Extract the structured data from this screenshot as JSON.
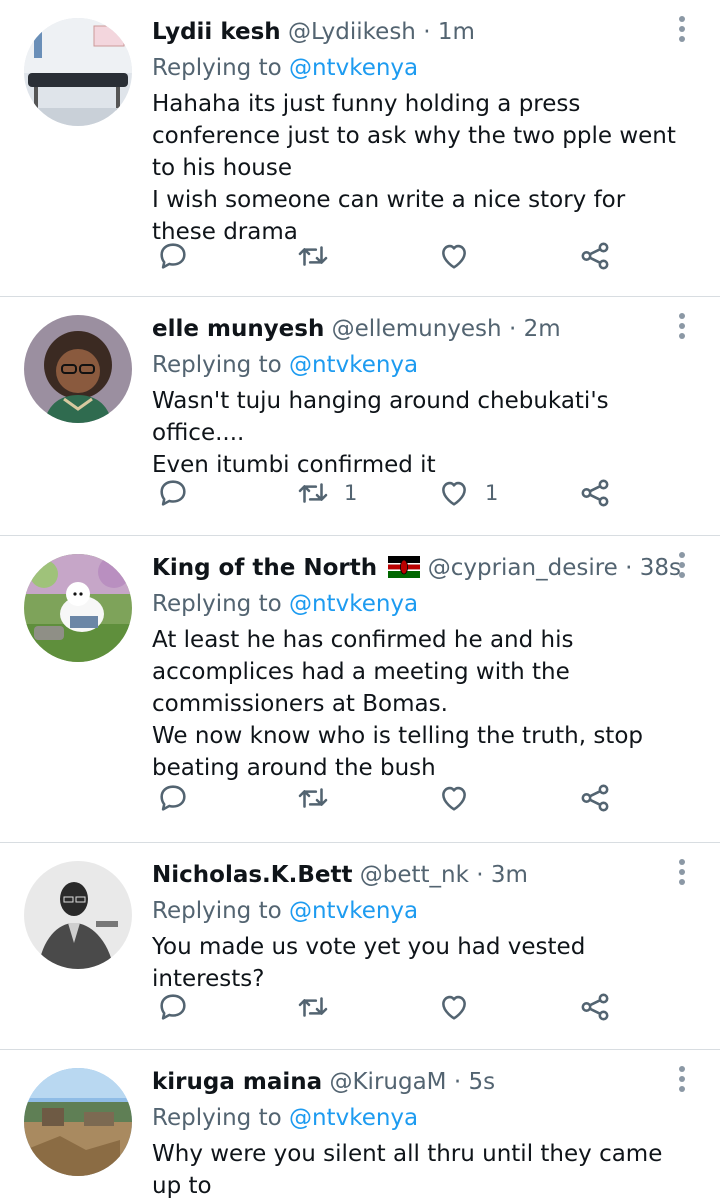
{
  "replying_prefix": "Replying to",
  "colors": {
    "accent": "#1d9bf0",
    "muted": "#536471",
    "divider": "#d8dde1"
  },
  "icons": [
    "reply-icon",
    "retweet-icon",
    "like-icon",
    "share-icon",
    "more-options-icon",
    "kenya-flag-icon"
  ],
  "tweets": [
    {
      "name": "Lydii kesh",
      "handle": "@Lydiikesh",
      "dot": "·",
      "time": "1m",
      "mention": "@ntvkenya",
      "text": "Hahaha its just funny holding a press conference just to  ask why the two pple went to his house\nI wish someone can write a nice story for these drama",
      "retweets": "",
      "likes": ""
    },
    {
      "name": "elle munyesh",
      "handle": "@ellemunyesh",
      "dot": "·",
      "time": "2m",
      "mention": "@ntvkenya",
      "text": "Wasn't tuju hanging around chebukati's office....\nEven itumbi confirmed it",
      "retweets": "1",
      "likes": "1"
    },
    {
      "name": "King of the North",
      "handle": "@cyprian_desire",
      "dot": "·",
      "time": "38s",
      "mention": "@ntvkenya",
      "text": "At least he has confirmed he and his accomplices had a meeting with the commissioners at Bomas.\nWe now know who is telling the truth, stop beating around the bush",
      "retweets": "",
      "likes": ""
    },
    {
      "name": "Nicholas.K.Bett",
      "handle": "@bett_nk",
      "dot": "·",
      "time": "3m",
      "mention": "@ntvkenya",
      "text": "You made us vote yet you had vested interests?",
      "retweets": "",
      "likes": ""
    },
    {
      "name": "kiruga maina",
      "handle": "@KirugaM",
      "dot": "·",
      "time": "5s",
      "mention": "@ntvkenya",
      "text": "Why were you silent all thru until they came up to",
      "retweets": "",
      "likes": ""
    }
  ]
}
